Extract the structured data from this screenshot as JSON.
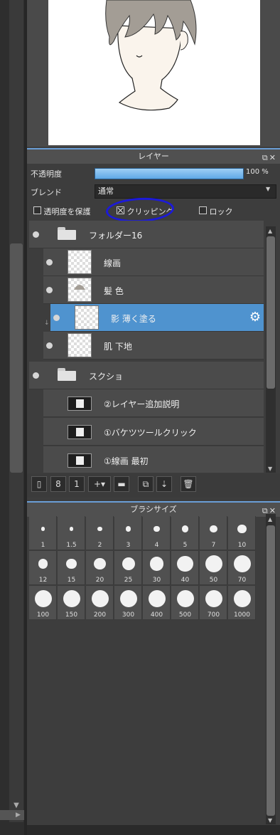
{
  "layer_panel": {
    "title": "レイヤー",
    "header_icons": "⧉✕",
    "opacity_label": "不透明度",
    "opacity_value": "100 %",
    "opacity_percent": 100,
    "blend_label": "ブレンド",
    "blend_value": "通常",
    "protect_alpha_label": "透明度を保護",
    "clipping_label": "クリッピング",
    "lock_label": "ロック",
    "clipping_checked": true,
    "layers": [
      {
        "name": "フォルダー16"
      },
      {
        "name": "線画"
      },
      {
        "name": "髪 色"
      },
      {
        "name": "影  薄く塗る"
      },
      {
        "name": "肌  下地"
      },
      {
        "name": "スクショ"
      },
      {
        "name": "②レイヤー追加説明"
      },
      {
        "name": "①バケツツールクリック"
      },
      {
        "name": "①線画  最初"
      }
    ]
  },
  "toolbar_icons": [
    "new-layer-icon",
    "new-8bit-layer-icon",
    "new-1bit-layer-icon",
    "add-layer-menu-icon",
    "new-folder-icon",
    "duplicate-icon",
    "merge-down-icon",
    "delete-icon"
  ],
  "brush_panel": {
    "title": "ブラシサイズ",
    "header_icons": "⧉✕",
    "sizes": [
      "1",
      "1.5",
      "2",
      "3",
      "4",
      "5",
      "7",
      "10",
      "12",
      "15",
      "20",
      "25",
      "30",
      "40",
      "50",
      "70",
      "100",
      "150",
      "200",
      "300",
      "400",
      "500",
      "700",
      "1000"
    ]
  },
  "colors": {
    "accent": "#4f93cf",
    "annotation_circle": "#1c1ad8",
    "panel": "#3d3d3d"
  }
}
